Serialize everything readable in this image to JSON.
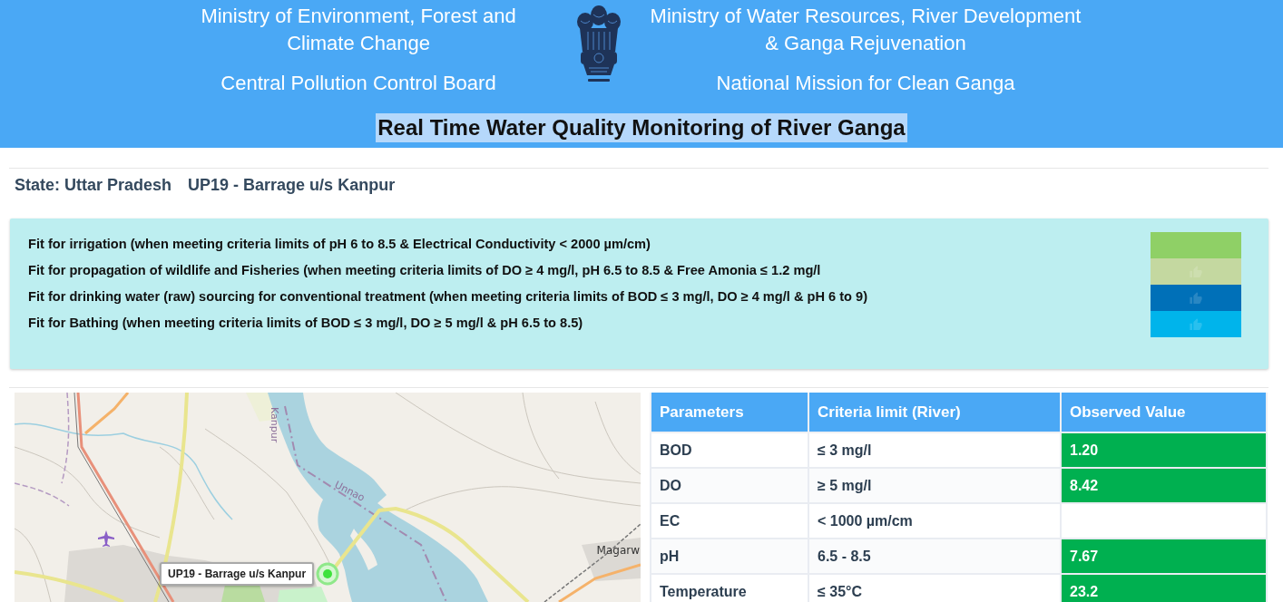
{
  "header": {
    "left": {
      "ministry": "Ministry of Environment, Forest and Climate Change",
      "agency": "Central Pollution Control Board"
    },
    "right": {
      "ministry": "Ministry of Water Resources, River Development & Ganga Rejuvenation",
      "agency": "National Mission for Clean Ganga"
    },
    "title": "Real Time Water Quality Monitoring of River Ganga",
    "title_highlighted": true
  },
  "station": {
    "state": "State: Uttar Pradesh",
    "name": "UP19 - Barrage u/s Kanpur"
  },
  "legend": [
    {
      "text": "Fit for irrigation (when meeting criteria limits of pH 6 to 8.5 & Electrical Conductivity < 2000 µm/cm)",
      "color": "#8fd066",
      "thumbs_up": false
    },
    {
      "text": "Fit for propagation of wildlife and Fisheries (when meeting criteria limits of DO ≥ 4 mg/l, pH 6.5 to 8.5 & Free Amonia ≤ 1.2 mg/l",
      "color": "#c4d8a0",
      "thumbs_up": true
    },
    {
      "text": "Fit for drinking water (raw) sourcing for conventional treatment (when meeting criteria limits of BOD ≤ 3 mg/l, DO ≥ 4 mg/l & pH 6 to 9)",
      "color": "#0070b8",
      "thumbs_up": true
    },
    {
      "text": "Fit for Bathing (when meeting criteria limits of BOD ≤ 3 mg/l, DO ≥ 5 mg/l & pH 6.5 to 8.5)",
      "color": "#00b4eb",
      "thumbs_up": true
    }
  ],
  "map": {
    "place_labels": [
      "Kanpur",
      "Unnao",
      "Magarw"
    ],
    "tooltip": "UP19 - Barrage u/s Kanpur"
  },
  "table": {
    "columns": [
      "Parameters",
      "Criteria limit (River)",
      "Observed Value"
    ],
    "rows": [
      {
        "parameter": "BOD",
        "criteria": "≤ 3 mg/l",
        "observed": "1.20",
        "color": "#00b050"
      },
      {
        "parameter": "DO",
        "criteria": "≥ 5 mg/l",
        "observed": "8.42",
        "color": "#00b050"
      },
      {
        "parameter": "EC",
        "criteria": "< 1000 µm/cm"
      },
      {
        "parameter": "pH",
        "criteria": "6.5 - 8.5",
        "observed": "7.67",
        "color": "#00b050"
      },
      {
        "parameter": "Temperature",
        "criteria": "≤ 35°C",
        "observed": "23.2",
        "color": "#00b050"
      }
    ]
  }
}
